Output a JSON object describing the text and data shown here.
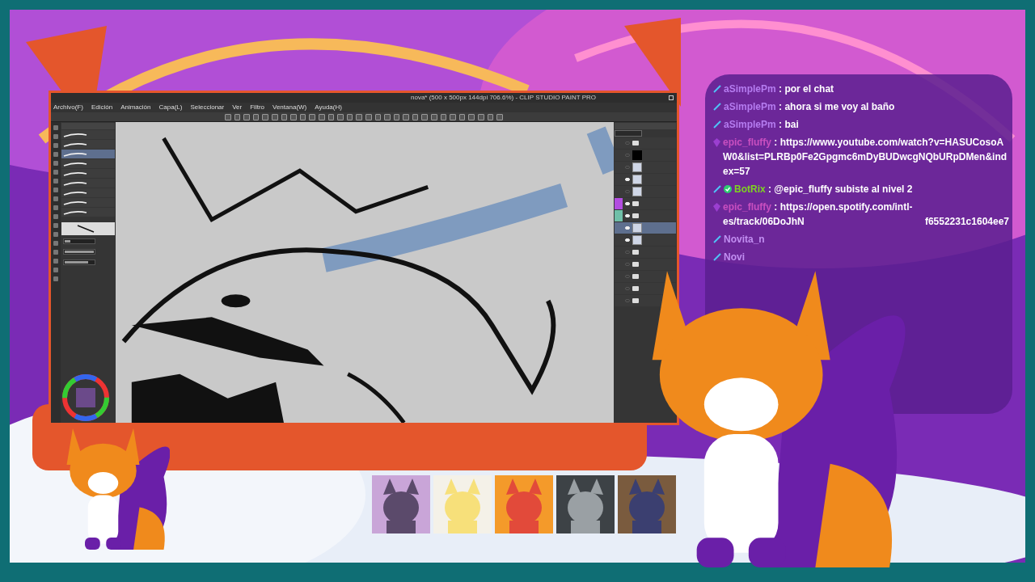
{
  "app_window": {
    "title": "nova* (500 x 500px 144dpi 706.6%) - CLIP STUDIO PAINT PRO",
    "menu": [
      "Archivo(F)",
      "Edición",
      "Animación",
      "Capa(L)",
      "Seleccionar",
      "Ver",
      "Filtro",
      "Ventana(W)",
      "Ayuda(H)"
    ],
    "brush_panel": {
      "brushes": [
        {
          "selected": false
        },
        {
          "selected": false
        },
        {
          "selected": true
        },
        {
          "selected": false
        },
        {
          "selected": false
        },
        {
          "selected": false
        },
        {
          "selected": false
        },
        {
          "selected": false
        },
        {
          "selected": false
        }
      ]
    },
    "tool_property": {
      "settings": [
        {
          "level": 0.2
        },
        {
          "level": 1
        },
        {
          "level": 0.8
        }
      ]
    },
    "layers_panel": {
      "layers": [
        {
          "kind": "folder",
          "visible": false,
          "selected": false
        },
        {
          "kind": "black",
          "visible": false,
          "selected": false
        },
        {
          "kind": "pattern",
          "visible": false,
          "selected": false
        },
        {
          "kind": "pattern",
          "visible": true,
          "selected": false
        },
        {
          "kind": "pattern",
          "visible": false,
          "selected": false
        },
        {
          "kind": "folder",
          "visible": true,
          "selected": false,
          "color": "#b24de0"
        },
        {
          "kind": "folder",
          "visible": true,
          "selected": false,
          "color": "#6fbfa8"
        },
        {
          "kind": "pattern",
          "visible": true,
          "selected": true
        },
        {
          "kind": "pattern",
          "visible": true,
          "selected": false
        },
        {
          "kind": "folder",
          "visible": false,
          "selected": false
        },
        {
          "kind": "folder",
          "visible": false,
          "selected": false
        },
        {
          "kind": "folder",
          "visible": false,
          "selected": false
        },
        {
          "kind": "folder",
          "visible": false,
          "selected": false
        },
        {
          "kind": "folder",
          "visible": false,
          "selected": false
        }
      ]
    }
  },
  "chat": [
    {
      "kind": "sword",
      "user": "aSimplePm",
      "color": "#b57cf0",
      "separator": ":",
      "text": "por el chat"
    },
    {
      "kind": "sword",
      "user": "aSimplePm",
      "color": "#b57cf0",
      "separator": ":",
      "text": "ahora si me voy al baño"
    },
    {
      "kind": "sword",
      "user": "aSimplePm",
      "color": "#b57cf0",
      "separator": ":",
      "text": "bai"
    },
    {
      "kind": "gem",
      "user": "epic_fluffy",
      "color": "#c94fc0",
      "separator": ":",
      "text": "https://www.youtube.com/watch?v=HASUCosoAW0&list=PLRBp0Fe2Gpgmc6mDyBUDwcgNQbURpDMen&index=57"
    },
    {
      "kind": "sword",
      "verified": true,
      "user": "BotRix",
      "color": "#7ed321",
      "separator": ":",
      "text": "@epic_fluffy subiste al nivel 2"
    },
    {
      "kind": "gem",
      "user": "epic_fluffy",
      "color": "#c94fc0",
      "separator": ":",
      "text": "https://open.spotify.com/intl-",
      "text_tail": "es/track/06DoJhN",
      "text_end": "f6552231c1604ee7"
    },
    {
      "kind": "sword",
      "user": "Novita_n",
      "color": "#c28ff2"
    },
    {
      "kind": "sword",
      "user": "Novi",
      "color": "#c28ff2"
    }
  ]
}
